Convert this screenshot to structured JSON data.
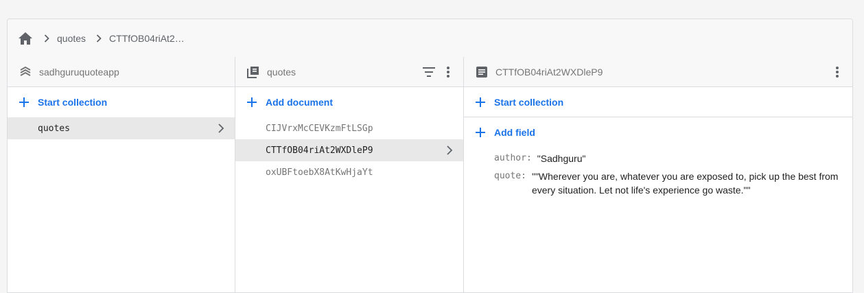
{
  "breadcrumb": {
    "home_icon": "home-icon",
    "items": [
      "quotes",
      "CTTfOB04riAt2…"
    ]
  },
  "columns": {
    "project": {
      "title": "sadhguruquoteapp",
      "icon": "firestore-stack-icon",
      "action_label": "Start collection",
      "items": [
        {
          "label": "quotes",
          "selected": true
        }
      ]
    },
    "collection": {
      "title": "quotes",
      "icon": "collection-icon",
      "action_label": "Add document",
      "items": [
        {
          "label": "CIJVrxMcCEVKzmFtLSGp",
          "selected": false
        },
        {
          "label": "CTTfOB04riAt2WXDleP9",
          "selected": true
        },
        {
          "label": "oxUBFtoebX8AtKwHjaYt",
          "selected": false
        }
      ]
    },
    "document": {
      "title": "CTTfOB04riAt2WXDleP9",
      "icon": "document-icon",
      "start_collection_label": "Start collection",
      "add_field_label": "Add field",
      "fields": [
        {
          "key": "author:",
          "value": "\"Sadhguru\""
        },
        {
          "key": "quote:",
          "value": "\"\"Wherever you are, whatever you are exposed to, pick up the best from every situation. Let not life's experience go waste.\"\""
        }
      ]
    }
  },
  "colors": {
    "accent": "#1a73e8",
    "selected_bg": "#e8e8e8",
    "border": "#dadce0"
  }
}
